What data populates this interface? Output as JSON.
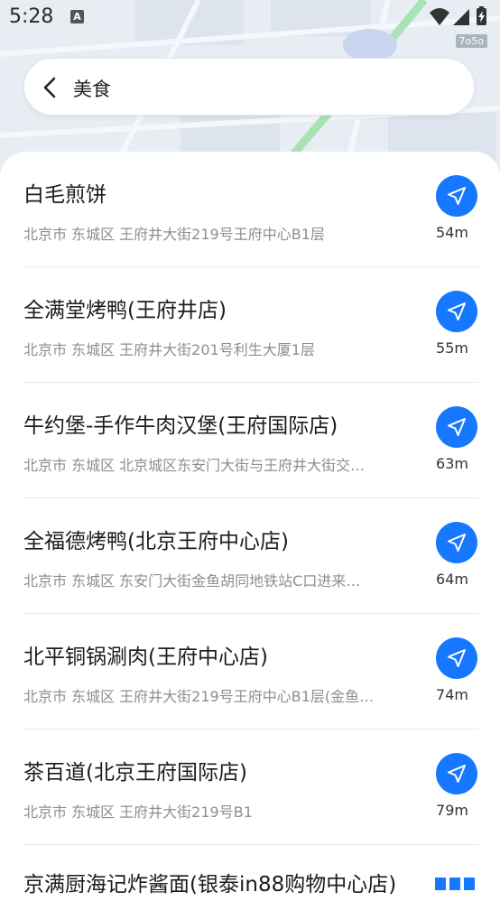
{
  "status_bar": {
    "time": "5:28",
    "notification_icon": "A",
    "icons": [
      "wifi-icon",
      "signal-icon",
      "battery-charging-icon"
    ]
  },
  "map": {
    "scale_label": "7o5o"
  },
  "search": {
    "back_icon": "chevron-left-icon",
    "query": "美食"
  },
  "colors": {
    "accent": "#1677ff",
    "name": "#1c1c1c",
    "address": "#8e8e8e"
  },
  "results": [
    {
      "name": "白毛煎饼",
      "address": "北京市 东城区 王府井大街219号王府中心B1层",
      "distance": "54m"
    },
    {
      "name": "全满堂烤鸭(王府井店)",
      "address": "北京市 东城区 王府井大街201号利生大厦1层",
      "distance": "55m"
    },
    {
      "name": "牛约堡-手作牛肉汉堡(王府国际店)",
      "address": "北京市 东城区 北京城区东安门大街与王府井大街交…",
      "distance": "63m"
    },
    {
      "name": "全福德烤鸭(北京王府中心店)",
      "address": "北京市 东城区 东安门大街金鱼胡同地铁站C口进来…",
      "distance": "64m"
    },
    {
      "name": "北平铜锅涮肉(王府中心店)",
      "address": "北京市 东城区 王府井大街219号王府中心B1层(金鱼…",
      "distance": "74m"
    },
    {
      "name": "茶百道(北京王府国际店)",
      "address": "北京市 东城区 王府井大街219号B1",
      "distance": "79m"
    }
  ],
  "partial_item": {
    "name": "京满厨海记炸酱面(银泰in88购物中心店)"
  }
}
